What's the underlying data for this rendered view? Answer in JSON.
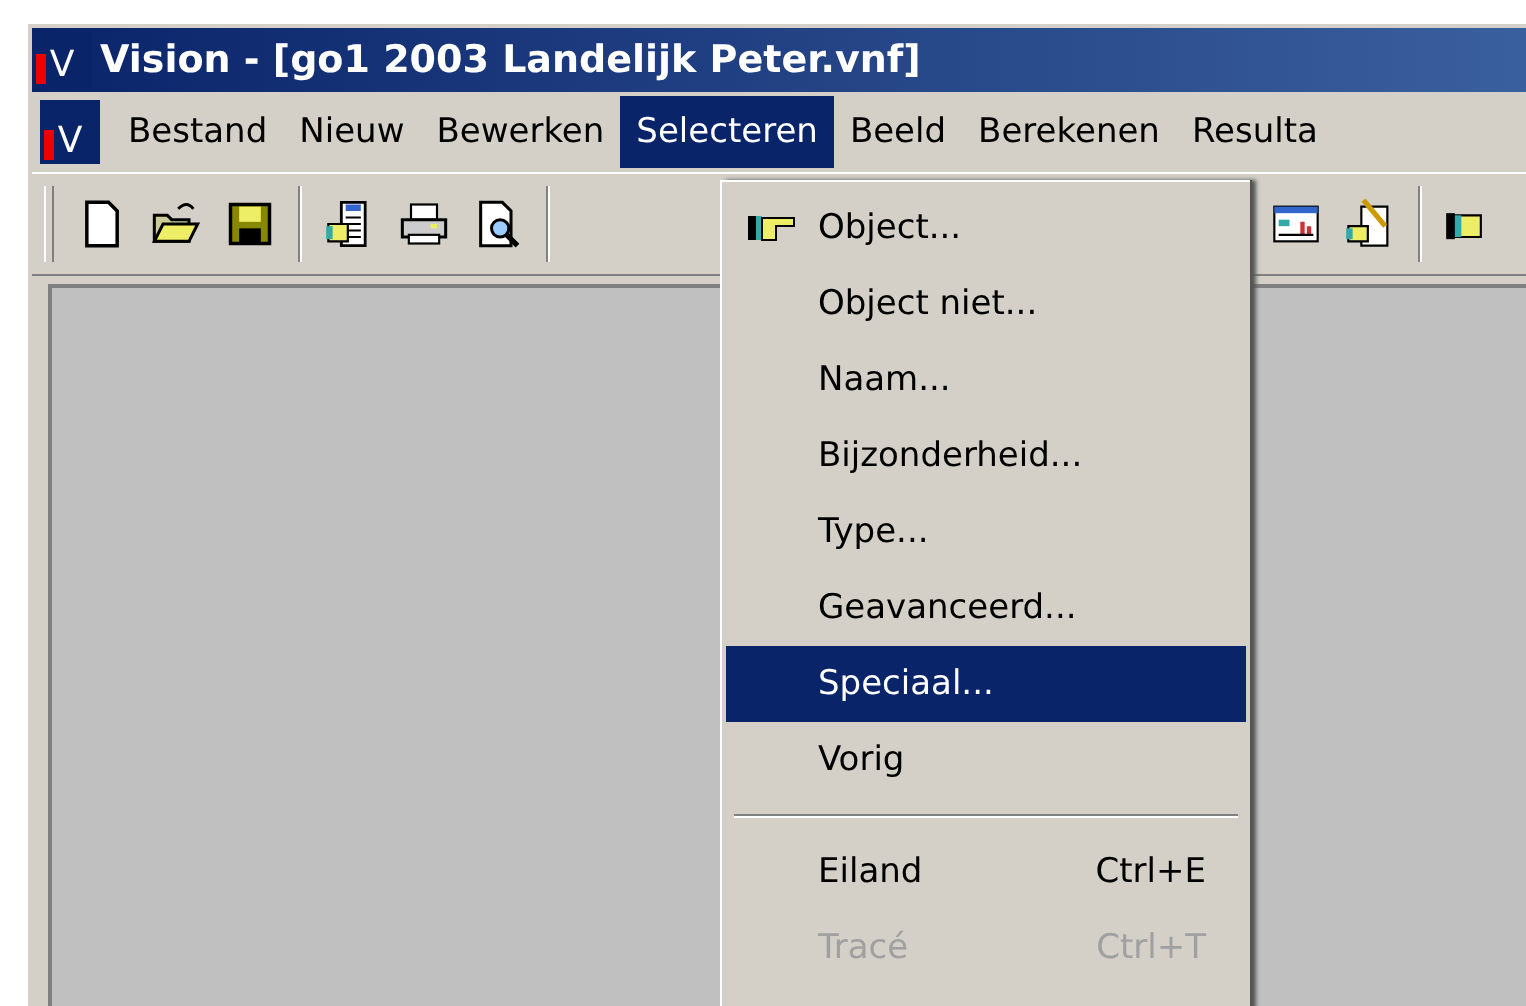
{
  "window": {
    "logo": "V",
    "title": "Vision - [go1 2003 Landelijk Peter.vnf]"
  },
  "menubar": {
    "logo": "V",
    "items": [
      {
        "label": "Bestand",
        "selected": false
      },
      {
        "label": "Nieuw",
        "selected": false
      },
      {
        "label": "Bewerken",
        "selected": false
      },
      {
        "label": "Selecteren",
        "selected": true
      },
      {
        "label": "Beeld",
        "selected": false
      },
      {
        "label": "Berekenen",
        "selected": false
      },
      {
        "label": "Resulta",
        "selected": false
      }
    ]
  },
  "menu": {
    "items": [
      {
        "kind": "item",
        "label": "Object...",
        "icon": true,
        "selected": false,
        "disabled": false
      },
      {
        "kind": "item",
        "label": "Object niet...",
        "icon": false,
        "selected": false,
        "disabled": false
      },
      {
        "kind": "item",
        "label": "Naam...",
        "icon": false,
        "selected": false,
        "disabled": false
      },
      {
        "kind": "item",
        "label": "Bijzonderheid...",
        "icon": false,
        "selected": false,
        "disabled": false
      },
      {
        "kind": "item",
        "label": "Type...",
        "icon": false,
        "selected": false,
        "disabled": false
      },
      {
        "kind": "item",
        "label": "Geavanceerd...",
        "icon": false,
        "selected": false,
        "disabled": false
      },
      {
        "kind": "item",
        "label": "Speciaal...",
        "icon": false,
        "selected": true,
        "disabled": false
      },
      {
        "kind": "item",
        "label": "Vorig",
        "icon": false,
        "selected": false,
        "disabled": false
      },
      {
        "kind": "separator"
      },
      {
        "kind": "item",
        "label": "Eiland",
        "shortcut": "Ctrl+E",
        "icon": false,
        "selected": false,
        "disabled": false
      },
      {
        "kind": "item",
        "label": "Tracé",
        "shortcut": "Ctrl+T",
        "icon": false,
        "selected": false,
        "disabled": true
      }
    ]
  }
}
